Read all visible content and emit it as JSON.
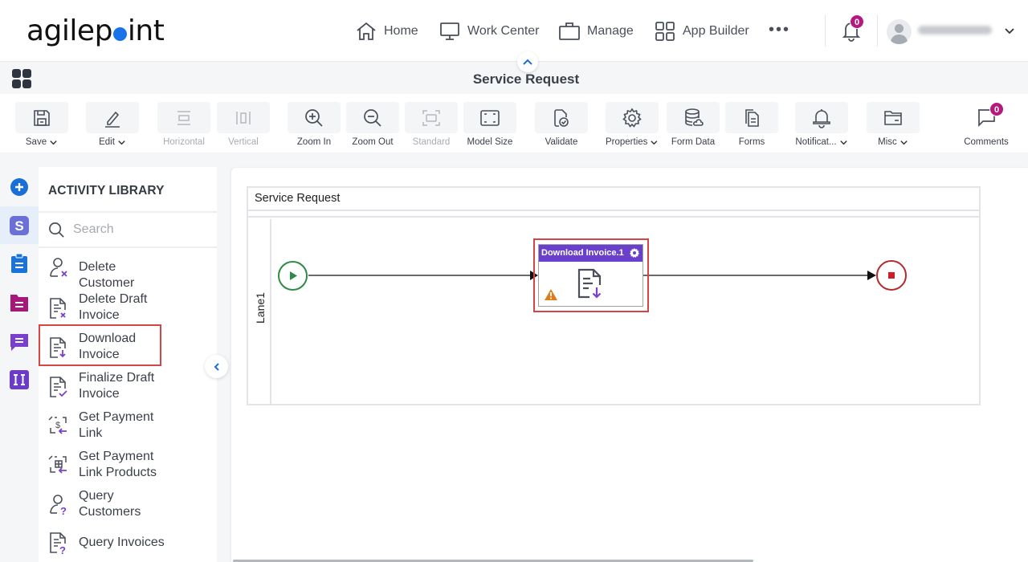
{
  "header": {
    "logo_text_left": "agilep",
    "logo_text_right": "int",
    "nav": [
      {
        "label": "Home",
        "icon": "home-icon"
      },
      {
        "label": "Work Center",
        "icon": "monitor-icon"
      },
      {
        "label": "Manage",
        "icon": "briefcase-icon"
      },
      {
        "label": "App Builder",
        "icon": "grid-icon"
      }
    ],
    "more_label": "•••",
    "notification_count": "0",
    "user_name": "(blurred)"
  },
  "titlebar": {
    "title": "Service Request"
  },
  "toolbar": {
    "items": [
      {
        "label": "Save",
        "icon": "save-icon",
        "dropdown": true,
        "disabled": false
      },
      {
        "label": "Edit",
        "icon": "pencil-icon",
        "dropdown": true,
        "disabled": false
      },
      {
        "label": "Horizontal",
        "icon": "horizontal-icon",
        "dropdown": false,
        "disabled": true
      },
      {
        "label": "Vertical",
        "icon": "vertical-icon",
        "dropdown": false,
        "disabled": true
      },
      {
        "label": "Zoom In",
        "icon": "zoom-in-icon",
        "dropdown": false,
        "disabled": false
      },
      {
        "label": "Zoom Out",
        "icon": "zoom-out-icon",
        "dropdown": false,
        "disabled": false
      },
      {
        "label": "Standard",
        "icon": "standard-icon",
        "dropdown": false,
        "disabled": true
      },
      {
        "label": "Model Size",
        "icon": "model-size-icon",
        "dropdown": false,
        "disabled": false
      },
      {
        "label": "Validate",
        "icon": "validate-icon",
        "dropdown": false,
        "disabled": false
      },
      {
        "label": "Properties",
        "icon": "gear-icon",
        "dropdown": true,
        "disabled": false
      },
      {
        "label": "Form Data",
        "icon": "database-icon",
        "dropdown": false,
        "disabled": false
      },
      {
        "label": "Forms",
        "icon": "forms-icon",
        "dropdown": false,
        "disabled": false
      },
      {
        "label": "Notificat...",
        "icon": "bell-icon",
        "dropdown": true,
        "disabled": false
      },
      {
        "label": "Misc",
        "icon": "folder-icon",
        "dropdown": true,
        "disabled": false
      },
      {
        "label": "Comments",
        "icon": "comment-icon",
        "dropdown": false,
        "disabled": false,
        "badge": "0"
      }
    ]
  },
  "rail": {
    "items": [
      {
        "name": "add",
        "icon": "plus-circle-icon",
        "color": "#1a6fd6"
      },
      {
        "name": "stripe",
        "icon": "stripe-icon",
        "color": "#6b6fd8",
        "active": true
      },
      {
        "name": "clipboard",
        "icon": "clipboard-icon",
        "color": "#1a73d9"
      },
      {
        "name": "folder",
        "icon": "folder-list-icon",
        "color": "#a8177a"
      },
      {
        "name": "chat",
        "icon": "chat-icon",
        "color": "#7a3fd0"
      },
      {
        "name": "text-field",
        "icon": "text-field-icon",
        "color": "#6a3cc8"
      }
    ]
  },
  "library": {
    "title": "ACTIVITY LIBRARY",
    "search_placeholder": "Search",
    "items": [
      {
        "label": "Delete Customer",
        "icon": "delete-customer-icon"
      },
      {
        "label": "Delete Draft Invoice",
        "icon": "delete-invoice-icon"
      },
      {
        "label": "Download Invoice",
        "icon": "download-invoice-icon",
        "highlighted": true
      },
      {
        "label": "Finalize Draft Invoice",
        "icon": "finalize-invoice-icon"
      },
      {
        "label": "Get Payment Link",
        "icon": "payment-link-icon"
      },
      {
        "label": "Get Payment Link Products",
        "icon": "payment-link-products-icon"
      },
      {
        "label": "Query Customers",
        "icon": "query-customers-icon"
      },
      {
        "label": "Query Invoices",
        "icon": "query-invoices-icon"
      }
    ]
  },
  "canvas": {
    "pool_title": "Service Request",
    "lane_label": "Lane1",
    "activity": {
      "title": "Download Invoice.1",
      "has_warning": true
    },
    "colors": {
      "start": "#2e8b47",
      "end": "#b22a2e",
      "activity_header": "#6a3fc9",
      "selection": "#d64545"
    }
  }
}
